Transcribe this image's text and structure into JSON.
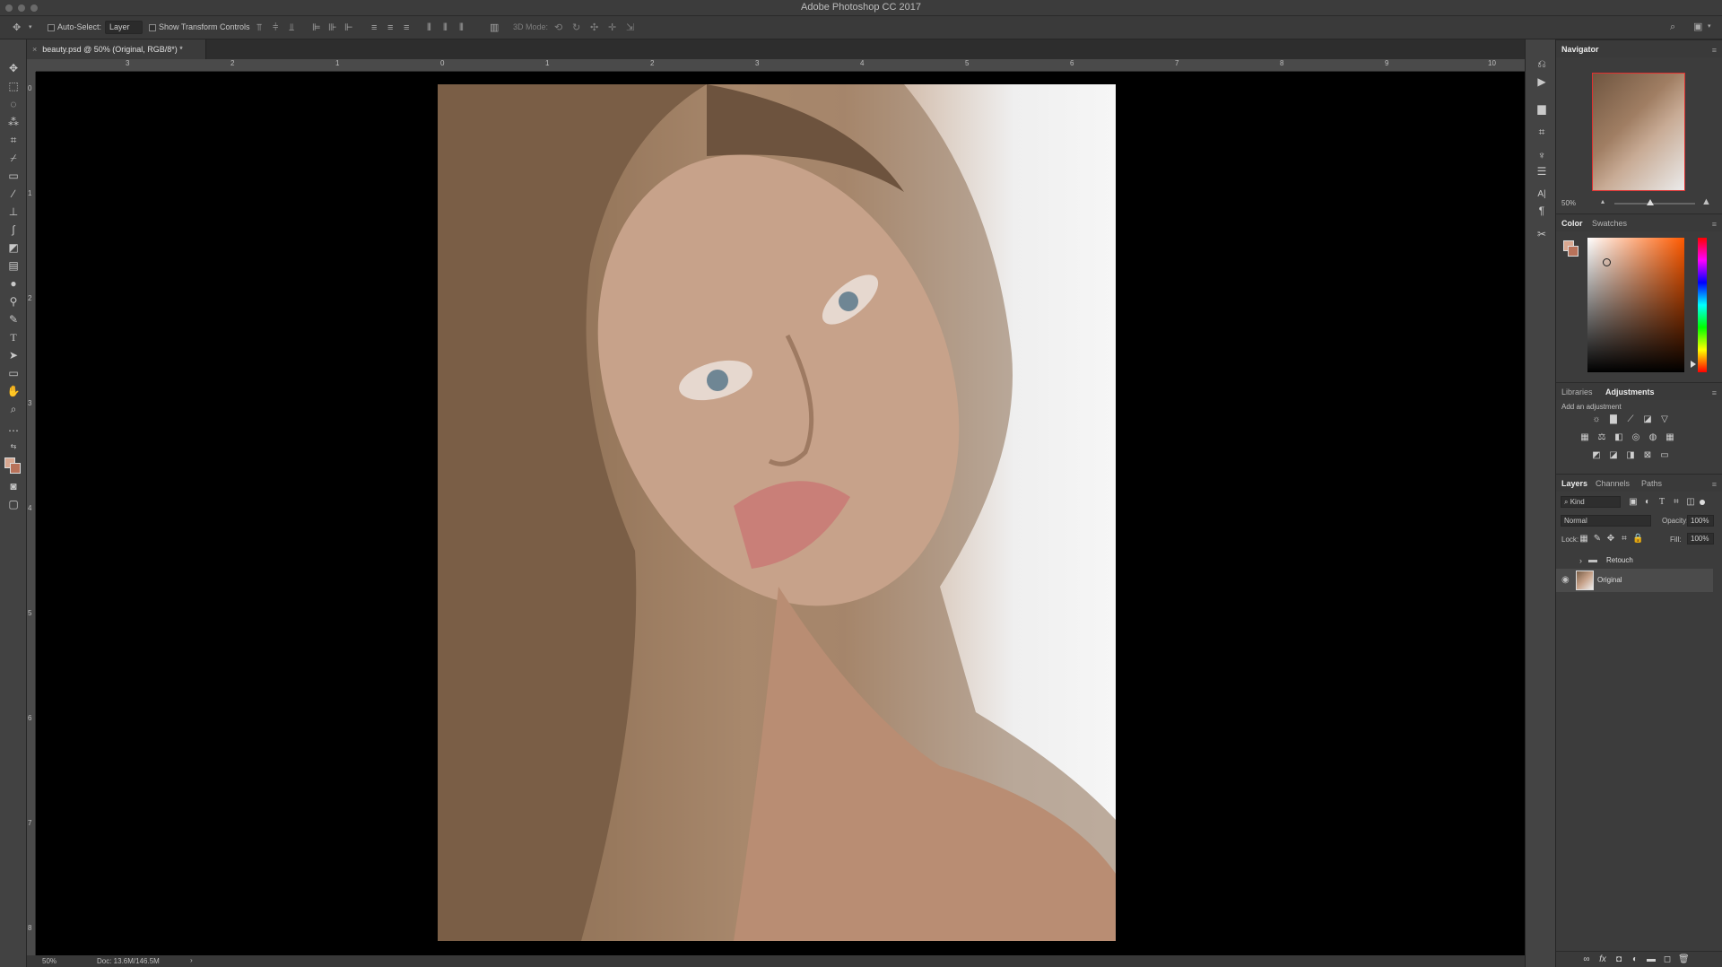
{
  "window": {
    "title": "Adobe Photoshop CC 2017"
  },
  "options_bar": {
    "auto_select_label": "Auto-Select:",
    "auto_select_value": "Layer",
    "show_transform_label": "Show Transform Controls",
    "mode_3d_label": "3D Mode:"
  },
  "document": {
    "tab_title": "beauty.psd @ 50% (Original, RGB/8*) *"
  },
  "rulers": {
    "top_ticks": [
      "3",
      "2",
      "1",
      "0",
      "1",
      "2",
      "3",
      "4",
      "5",
      "6",
      "7",
      "8",
      "9",
      "10"
    ],
    "left_ticks": [
      "0",
      "1",
      "2",
      "3",
      "4",
      "5",
      "6",
      "7",
      "8"
    ]
  },
  "status_bar": {
    "zoom": "50%",
    "doc_size": "Doc: 13.6M/146.5M",
    "arrow": "›"
  },
  "navigator": {
    "title": "Navigator",
    "zoom": "50%"
  },
  "color_panel": {
    "tabs": [
      "Color",
      "Swatches"
    ],
    "active_tab": "Color",
    "foreground_color": "#d9a891",
    "background_color": "#b8725a"
  },
  "adjustments_panel": {
    "tabs": [
      "Libraries",
      "Adjustments"
    ],
    "active_tab": "Adjustments",
    "hint": "Add an adjustment"
  },
  "layers_panel": {
    "tabs": [
      "Layers",
      "Channels",
      "Paths"
    ],
    "active_tab": "Layers",
    "filter": "Kind",
    "blend_mode": "Normal",
    "opacity_label": "Opacity:",
    "opacity_value": "100%",
    "lock_label": "Lock:",
    "fill_label": "Fill:",
    "fill_value": "100%",
    "layers": [
      {
        "name": "Retouch",
        "type": "group"
      },
      {
        "name": "Original",
        "type": "image",
        "selected": true
      }
    ]
  }
}
